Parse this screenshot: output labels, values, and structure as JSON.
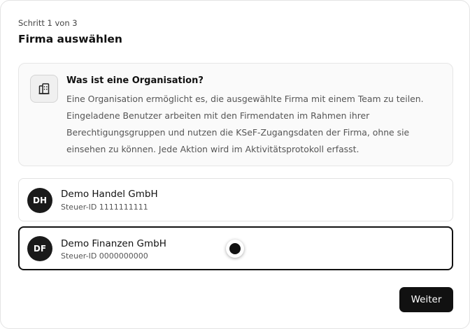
{
  "dialog": {
    "step_label": "Schritt 1 von 3",
    "title": "Firma auswählen"
  },
  "info": {
    "icon": "building-icon",
    "title": "Was ist eine Organisation?",
    "body": "Eine Organisation ermöglicht es, die ausgewählte Firma mit einem Team zu teilen. Eingeladene Benutzer arbeiten mit den Firmendaten im Rahmen ihrer Berechtigungsgruppen und nutzen die KSeF-Zugangsdaten der Firma, ohne sie einsehen zu können. Jede Aktion wird im Aktivitätsprotokoll erfasst."
  },
  "companies": [
    {
      "initials": "DH",
      "name": "Demo Handel GmbH",
      "tax_id": "Steuer-ID 1111111111",
      "selected": false
    },
    {
      "initials": "DF",
      "name": "Demo Finanzen GmbH",
      "tax_id": "Steuer-ID 0000000000",
      "selected": true
    }
  ],
  "actions": {
    "next_label": "Weiter"
  },
  "colors": {
    "primary": "#111111",
    "avatar_bg": "#1a1a1a",
    "info_bg": "#fafafa",
    "muted_text": "#555555"
  }
}
